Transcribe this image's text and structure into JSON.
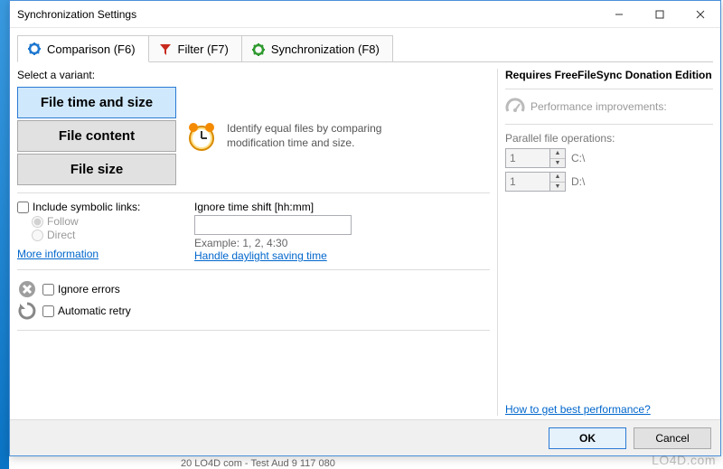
{
  "window": {
    "title": "Synchronization Settings"
  },
  "tabs": {
    "comparison": "Comparison (F6)",
    "filter": "Filter (F7)",
    "synchronization": "Synchronization (F8)"
  },
  "variant": {
    "label": "Select a variant:",
    "options": {
      "time_size": "File time and size",
      "content": "File content",
      "size": "File size"
    },
    "description": "Identify equal files by comparing modification time and size."
  },
  "symlinks": {
    "label": "Include symbolic links:",
    "follow": "Follow",
    "direct": "Direct",
    "more_info": "More information"
  },
  "timeshift": {
    "label": "Ignore time shift [hh:mm]",
    "value": "",
    "example": "Example: 1, 2, 4:30",
    "dst_link": "Handle daylight saving time"
  },
  "errors": {
    "ignore": "Ignore errors",
    "retry": "Automatic retry"
  },
  "right": {
    "title": "Requires FreeFileSync Donation Edition",
    "perf": "Performance improvements:",
    "pfo": "Parallel file operations:",
    "rows": [
      {
        "value": "1",
        "drive": "C:\\"
      },
      {
        "value": "1",
        "drive": "D:\\"
      }
    ],
    "best_link": "How to get best performance?"
  },
  "footer": {
    "ok": "OK",
    "cancel": "Cancel"
  },
  "watermark": "LO4D.com",
  "scrap": "20   LO4D com - Test Aud               9 117 080"
}
